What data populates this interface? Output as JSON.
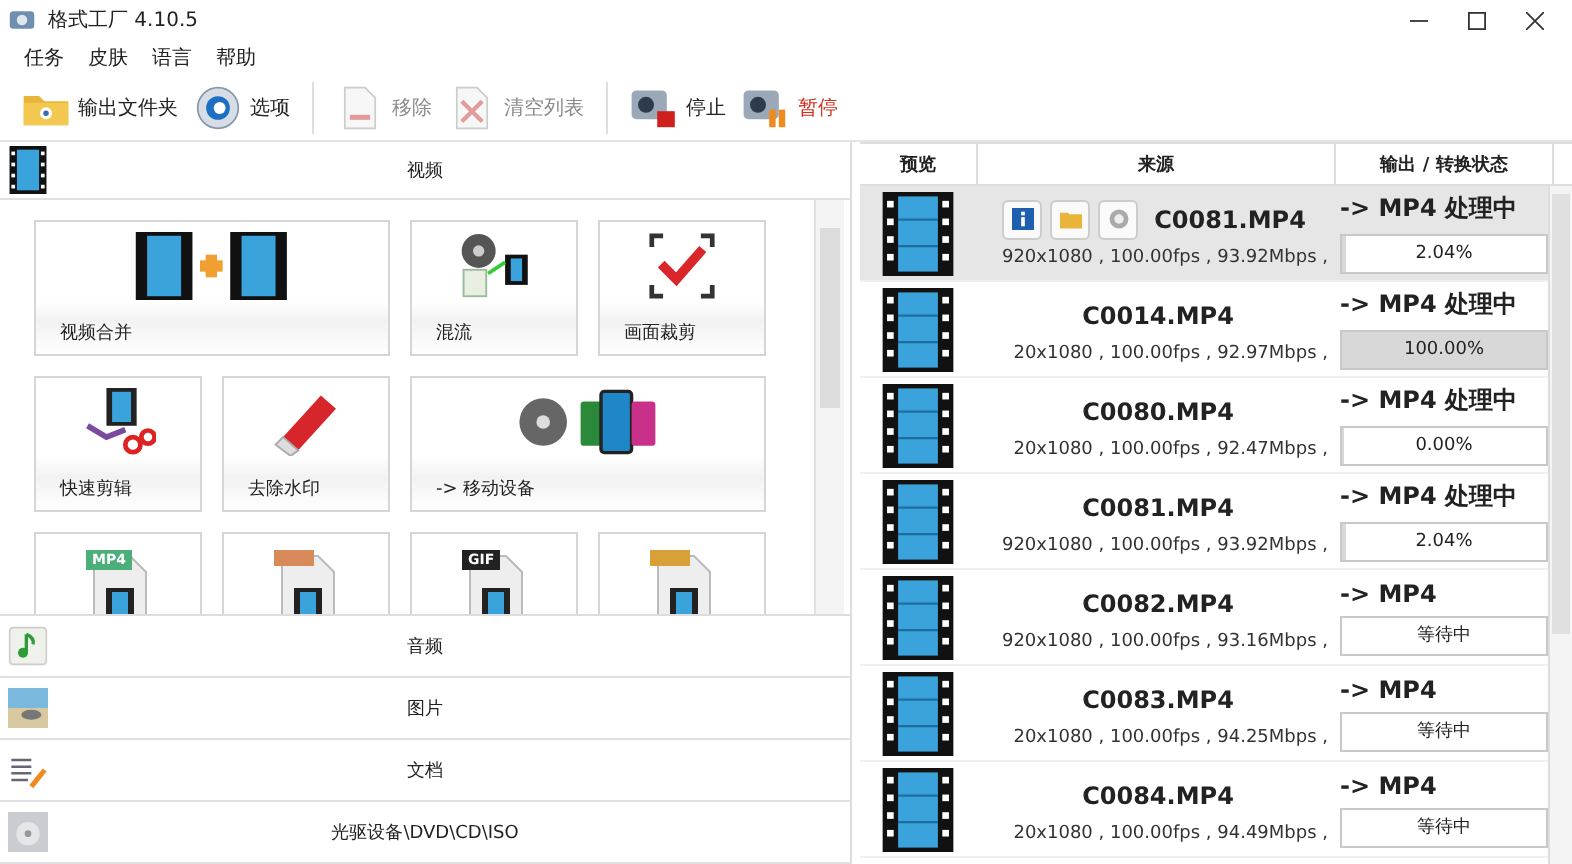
{
  "window": {
    "title": "格式工厂 4.10.5"
  },
  "menu": [
    "任务",
    "皮肤",
    "语言",
    "帮助"
  ],
  "toolbar": [
    {
      "label": "输出文件夹",
      "kind": "folder",
      "disabled": false,
      "highlighted": false
    },
    {
      "label": "选项",
      "kind": "options",
      "disabled": false,
      "highlighted": false
    },
    {
      "label": "移除",
      "kind": "remove",
      "disabled": true,
      "highlighted": false
    },
    {
      "label": "清空列表",
      "kind": "clear",
      "disabled": true,
      "highlighted": false
    },
    {
      "label": "停止",
      "kind": "stop",
      "disabled": false,
      "highlighted": false
    },
    {
      "label": "暂停",
      "kind": "pause",
      "disabled": false,
      "highlighted": true
    }
  ],
  "categories_top": [
    {
      "label": "视频",
      "kind": "video"
    }
  ],
  "tiles": [
    {
      "label": "视频合并",
      "kind": "merge",
      "wide": true
    },
    {
      "label": "混流",
      "kind": "mux",
      "wide": false
    },
    {
      "label": "画面裁剪",
      "kind": "crop",
      "wide": false
    },
    {
      "label": "快速剪辑",
      "kind": "cut",
      "wide": false
    },
    {
      "label": "去除水印",
      "kind": "eraser",
      "wide": false
    },
    {
      "label": "-> 移动设备",
      "kind": "mobile",
      "wide": true
    },
    {
      "kind": "file",
      "badge": "MP4",
      "color": "#4caf7a",
      "wide": false
    },
    {
      "kind": "file",
      "color": "#d98a5a",
      "wide": false
    },
    {
      "kind": "file",
      "badge": "GIF",
      "color": "#222222",
      "wide": false
    },
    {
      "kind": "file",
      "color": "#d9a03a",
      "wide": false
    }
  ],
  "categories_bottom": [
    {
      "label": "音频",
      "kind": "audio"
    },
    {
      "label": "图片",
      "kind": "picture"
    },
    {
      "label": "文档",
      "kind": "document"
    },
    {
      "label": "光驱设备\\DVD\\CD\\ISO",
      "kind": "disc"
    }
  ],
  "table": {
    "columns": [
      "预览",
      "来源",
      "输出 / 转换状态"
    ],
    "rows": [
      {
        "name": "C0081.MP4",
        "details": "920x1080 , 100.00fps , 93.92Mbps ,",
        "output": "-> MP4 处理中",
        "status": "2.04%",
        "level": 0.0204,
        "selected": true
      },
      {
        "name": "C0014.MP4",
        "details": "20x1080 , 100.00fps , 92.97Mbps ,",
        "output": "-> MP4 处理中",
        "status": "100.00%",
        "level": 1,
        "selected": false
      },
      {
        "name": "C0080.MP4",
        "details": "20x1080 , 100.00fps , 92.47Mbps ,",
        "output": "-> MP4 处理中",
        "status": "0.00%",
        "level": 0,
        "selected": false
      },
      {
        "name": "C0081.MP4",
        "details": "920x1080 , 100.00fps , 93.92Mbps ,",
        "output": "-> MP4 处理中",
        "status": "2.04%",
        "level": 0.0204,
        "selected": false
      },
      {
        "name": "C0082.MP4",
        "details": "920x1080 , 100.00fps , 93.16Mbps ,",
        "output": "-> MP4",
        "status": "等待中",
        "selected": false
      },
      {
        "name": "C0083.MP4",
        "details": "20x1080 , 100.00fps , 94.25Mbps ,",
        "output": "-> MP4",
        "status": "等待中",
        "selected": false
      },
      {
        "name": "C0084.MP4",
        "details": "20x1080 , 100.00fps , 94.49Mbps ,",
        "output": "-> MP4",
        "status": "等待中",
        "selected": false
      }
    ]
  }
}
